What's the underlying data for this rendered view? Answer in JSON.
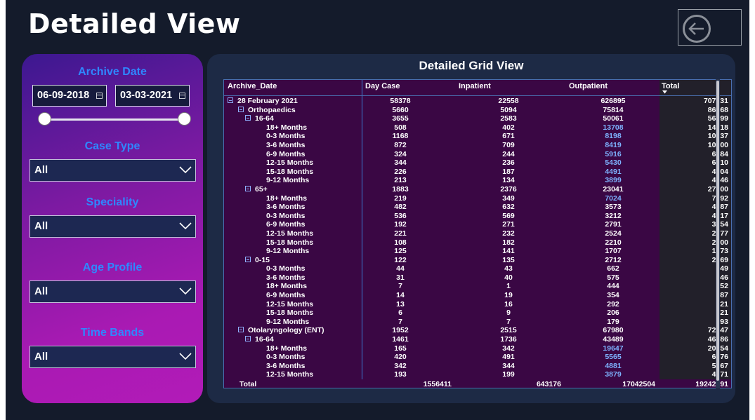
{
  "page_title": "Detailed View",
  "filters": {
    "archive_date": {
      "label": "Archive Date",
      "start": "06-09-2018",
      "end": "03-03-2021",
      "slider_start_fraction": 0.0,
      "slider_end_fraction": 1.0
    },
    "case_type": {
      "label": "Case Type",
      "value": "All"
    },
    "speciality": {
      "label": "Speciality",
      "value": "All"
    },
    "age_profile": {
      "label": "Age Profile",
      "value": "All"
    },
    "time_bands": {
      "label": "Time Bands",
      "value": "All"
    }
  },
  "grid": {
    "title": "Detailed Grid View",
    "columns": [
      "Archive_Date",
      "Day Case",
      "Inpatient",
      "Outpatient",
      "Total"
    ],
    "rows": [
      {
        "label": "28 February 2021",
        "level": 0,
        "expand": true,
        "day": "58378",
        "in": "22558",
        "out": "626895",
        "total": "707831",
        "blue": false
      },
      {
        "label": "Orthopaedics",
        "level": 1,
        "expand": true,
        "day": "5660",
        "in": "5094",
        "out": "75814",
        "total": "86568",
        "blue": false
      },
      {
        "label": "16-64",
        "level": 2,
        "expand": true,
        "day": "3655",
        "in": "2583",
        "out": "50061",
        "total": "56299",
        "blue": false
      },
      {
        "label": "18+ Months",
        "level": 3,
        "expand": false,
        "day": "508",
        "in": "402",
        "out": "13708",
        "total": "14618",
        "blue": true
      },
      {
        "label": "0-3 Months",
        "level": 3,
        "expand": false,
        "day": "1168",
        "in": "671",
        "out": "8198",
        "total": "10037",
        "blue": true
      },
      {
        "label": "3-6 Months",
        "level": 3,
        "expand": false,
        "day": "872",
        "in": "709",
        "out": "8419",
        "total": "10000",
        "blue": true
      },
      {
        "label": "6-9 Months",
        "level": 3,
        "expand": false,
        "day": "324",
        "in": "244",
        "out": "5916",
        "total": "6484",
        "blue": true
      },
      {
        "label": "12-15 Months",
        "level": 3,
        "expand": false,
        "day": "344",
        "in": "236",
        "out": "5430",
        "total": "6010",
        "blue": true
      },
      {
        "label": "15-18 Months",
        "level": 3,
        "expand": false,
        "day": "226",
        "in": "187",
        "out": "4491",
        "total": "4904",
        "blue": true
      },
      {
        "label": "9-12 Months",
        "level": 3,
        "expand": false,
        "day": "213",
        "in": "134",
        "out": "3899",
        "total": "4246",
        "blue": true
      },
      {
        "label": "65+",
        "level": 2,
        "expand": true,
        "day": "1883",
        "in": "2376",
        "out": "23041",
        "total": "27300",
        "blue": false
      },
      {
        "label": "18+ Months",
        "level": 3,
        "expand": false,
        "day": "219",
        "in": "349",
        "out": "7024",
        "total": "7592",
        "blue": true
      },
      {
        "label": "3-6 Months",
        "level": 3,
        "expand": false,
        "day": "482",
        "in": "632",
        "out": "3573",
        "total": "4687",
        "blue": false
      },
      {
        "label": "0-3 Months",
        "level": 3,
        "expand": false,
        "day": "536",
        "in": "569",
        "out": "3212",
        "total": "4317",
        "blue": false
      },
      {
        "label": "6-9 Months",
        "level": 3,
        "expand": false,
        "day": "192",
        "in": "271",
        "out": "2791",
        "total": "3254",
        "blue": false
      },
      {
        "label": "12-15 Months",
        "level": 3,
        "expand": false,
        "day": "221",
        "in": "232",
        "out": "2524",
        "total": "2977",
        "blue": false
      },
      {
        "label": "15-18 Months",
        "level": 3,
        "expand": false,
        "day": "108",
        "in": "182",
        "out": "2210",
        "total": "2500",
        "blue": false
      },
      {
        "label": "9-12 Months",
        "level": 3,
        "expand": false,
        "day": "125",
        "in": "141",
        "out": "1707",
        "total": "1973",
        "blue": false
      },
      {
        "label": "0-15",
        "level": 2,
        "expand": true,
        "day": "122",
        "in": "135",
        "out": "2712",
        "total": "2969",
        "blue": false
      },
      {
        "label": "0-3 Months",
        "level": 3,
        "expand": false,
        "day": "44",
        "in": "43",
        "out": "662",
        "total": "749",
        "blue": false
      },
      {
        "label": "3-6 Months",
        "level": 3,
        "expand": false,
        "day": "31",
        "in": "40",
        "out": "575",
        "total": "646",
        "blue": false
      },
      {
        "label": "18+ Months",
        "level": 3,
        "expand": false,
        "day": "7",
        "in": "1",
        "out": "444",
        "total": "452",
        "blue": false
      },
      {
        "label": "6-9 Months",
        "level": 3,
        "expand": false,
        "day": "14",
        "in": "19",
        "out": "354",
        "total": "387",
        "blue": false
      },
      {
        "label": "12-15 Months",
        "level": 3,
        "expand": false,
        "day": "13",
        "in": "16",
        "out": "292",
        "total": "321",
        "blue": false
      },
      {
        "label": "15-18 Months",
        "level": 3,
        "expand": false,
        "day": "6",
        "in": "9",
        "out": "206",
        "total": "221",
        "blue": false
      },
      {
        "label": "9-12 Months",
        "level": 3,
        "expand": false,
        "day": "7",
        "in": "7",
        "out": "179",
        "total": "193",
        "blue": false
      },
      {
        "label": "Otolaryngology (ENT)",
        "level": 1,
        "expand": true,
        "day": "1952",
        "in": "2515",
        "out": "67980",
        "total": "72447",
        "blue": false
      },
      {
        "label": "16-64",
        "level": 2,
        "expand": true,
        "day": "1461",
        "in": "1736",
        "out": "43489",
        "total": "46686",
        "blue": false
      },
      {
        "label": "18+ Months",
        "level": 3,
        "expand": false,
        "day": "165",
        "in": "342",
        "out": "19647",
        "total": "20154",
        "blue": true
      },
      {
        "label": "0-3 Months",
        "level": 3,
        "expand": false,
        "day": "420",
        "in": "491",
        "out": "5565",
        "total": "6476",
        "blue": true
      },
      {
        "label": "3-6 Months",
        "level": 3,
        "expand": false,
        "day": "342",
        "in": "344",
        "out": "4881",
        "total": "5567",
        "blue": true
      },
      {
        "label": "12-15 Months",
        "level": 3,
        "expand": false,
        "day": "193",
        "in": "199",
        "out": "3879",
        "total": "4271",
        "blue": true
      }
    ],
    "total_row": {
      "label": "Total",
      "day": "1556411",
      "in": "643176",
      "out": "17042504",
      "total": "19242091"
    }
  },
  "colors": {
    "background": "#141b2b",
    "filter_label": "#2f87ff",
    "grid_bg": "#3a0744",
    "highlight_value": "#7eb3ff"
  },
  "icons": [
    "back-arrow-icon",
    "calendar-icon",
    "chevron-down-icon",
    "expand-minus-icon"
  ]
}
